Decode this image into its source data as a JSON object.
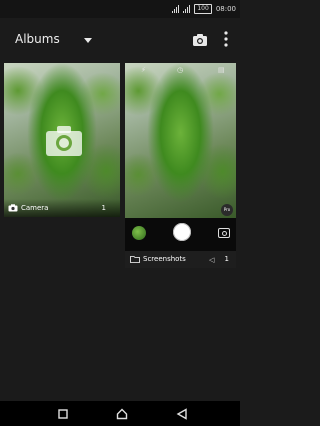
{
  "status_bar": {
    "battery": "100",
    "time": "08:00"
  },
  "app_bar": {
    "title": "Albums",
    "dropdown_icon": "caret-down-icon",
    "camera_action_icon": "camera-icon",
    "more_icon": "more-vertical-icon"
  },
  "albums": [
    {
      "label": "Camera",
      "count": "1",
      "icon": "camera-icon"
    },
    {
      "label": "Screenshots",
      "count": "1",
      "icon": "folder-icon"
    }
  ],
  "viewfinder": {
    "pro_badge": "Pro"
  },
  "nav_bar": {
    "items": [
      "square-recents-icon",
      "home-icon",
      "back-icon"
    ]
  },
  "colors": {
    "background": "#1b1b1b",
    "nav_background": "#000000",
    "text": "#ffffff"
  }
}
